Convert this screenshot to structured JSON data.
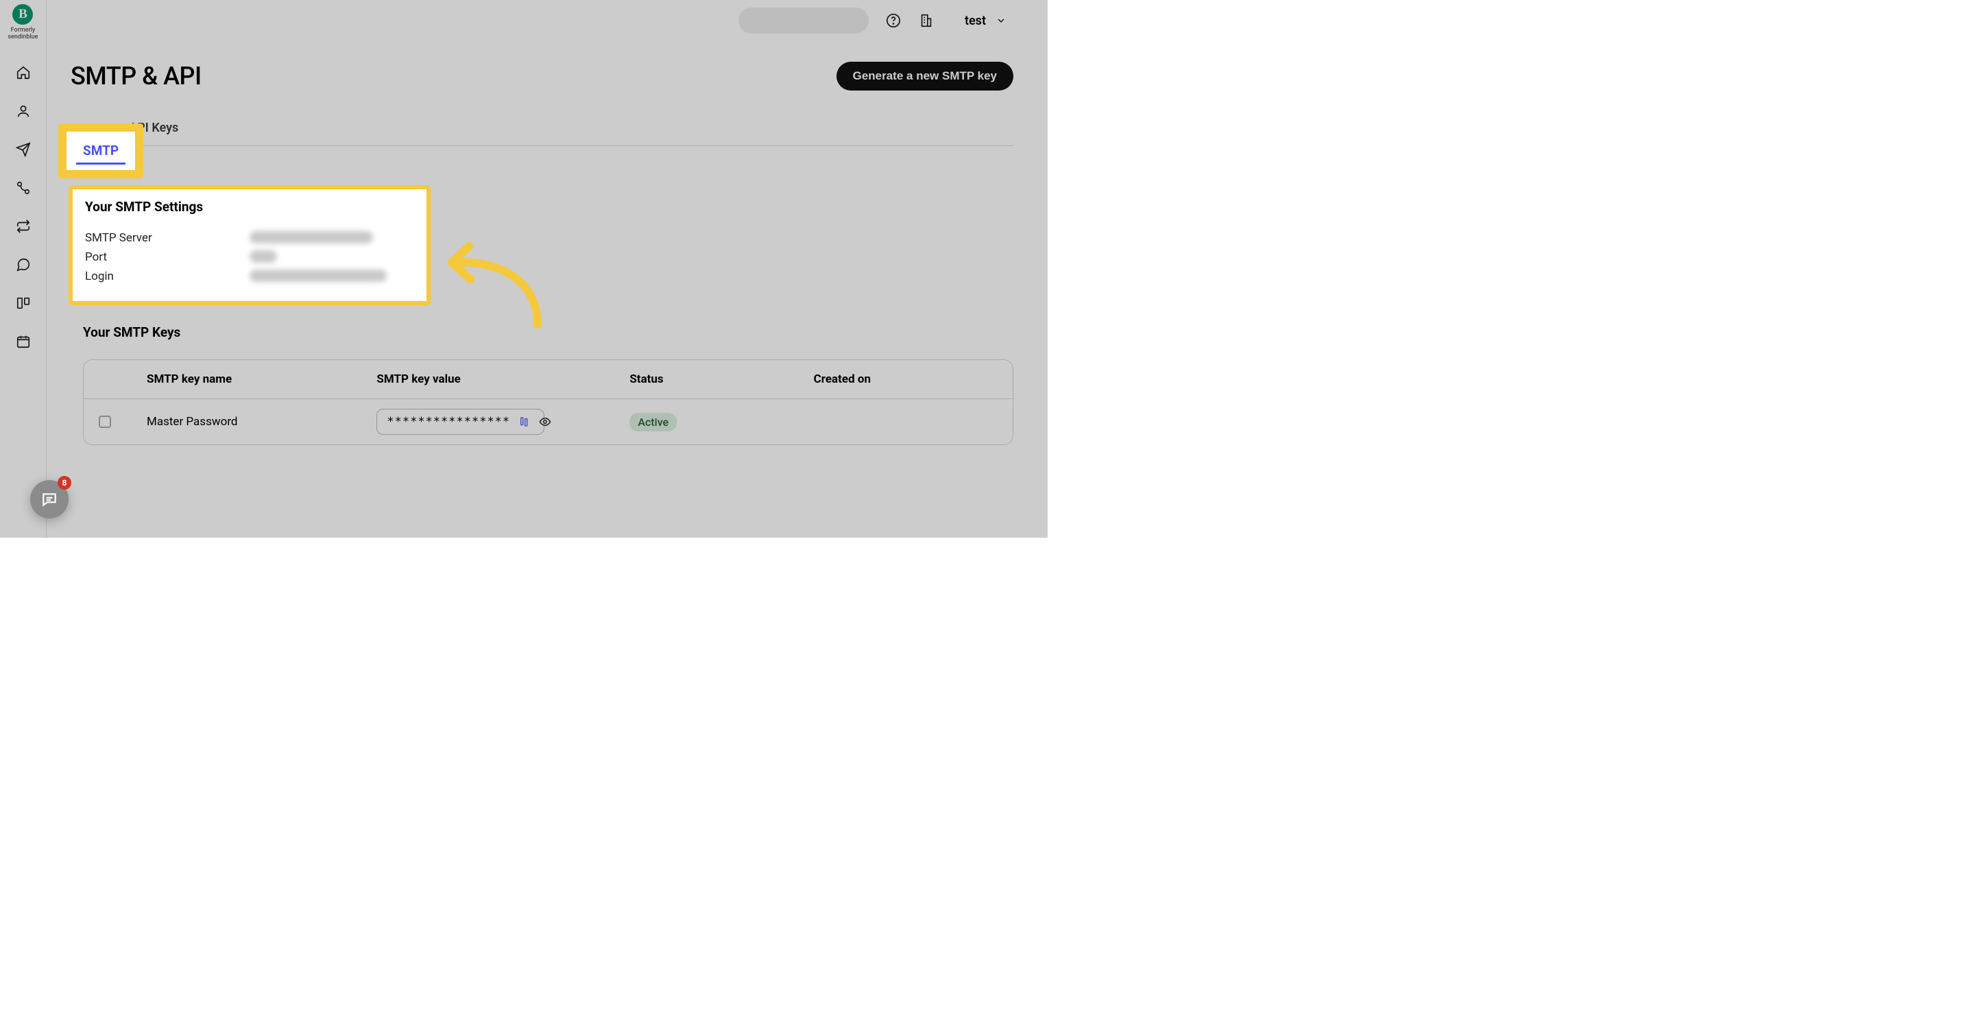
{
  "brand": {
    "logo_letter": "B",
    "sub_line1": "Formerly",
    "sub_line2": "sendinblue"
  },
  "header": {
    "account_name": "test"
  },
  "page": {
    "title": "SMTP & API",
    "primary_action": "Generate a new SMTP key"
  },
  "tabs": {
    "smtp": "SMTP",
    "api_keys": "API Keys"
  },
  "smtp_settings": {
    "heading": "Your SMTP Settings",
    "labels": {
      "server": "SMTP Server",
      "port": "Port",
      "login": "Login"
    }
  },
  "smtp_keys": {
    "heading": "Your SMTP Keys",
    "columns": {
      "name": "SMTP key name",
      "value": "SMTP key value",
      "status": "Status",
      "created": "Created on"
    },
    "rows": [
      {
        "name": "Master Password",
        "masked_value": "****************",
        "status": "Active",
        "created": ""
      }
    ]
  },
  "chat": {
    "badge": "8"
  }
}
